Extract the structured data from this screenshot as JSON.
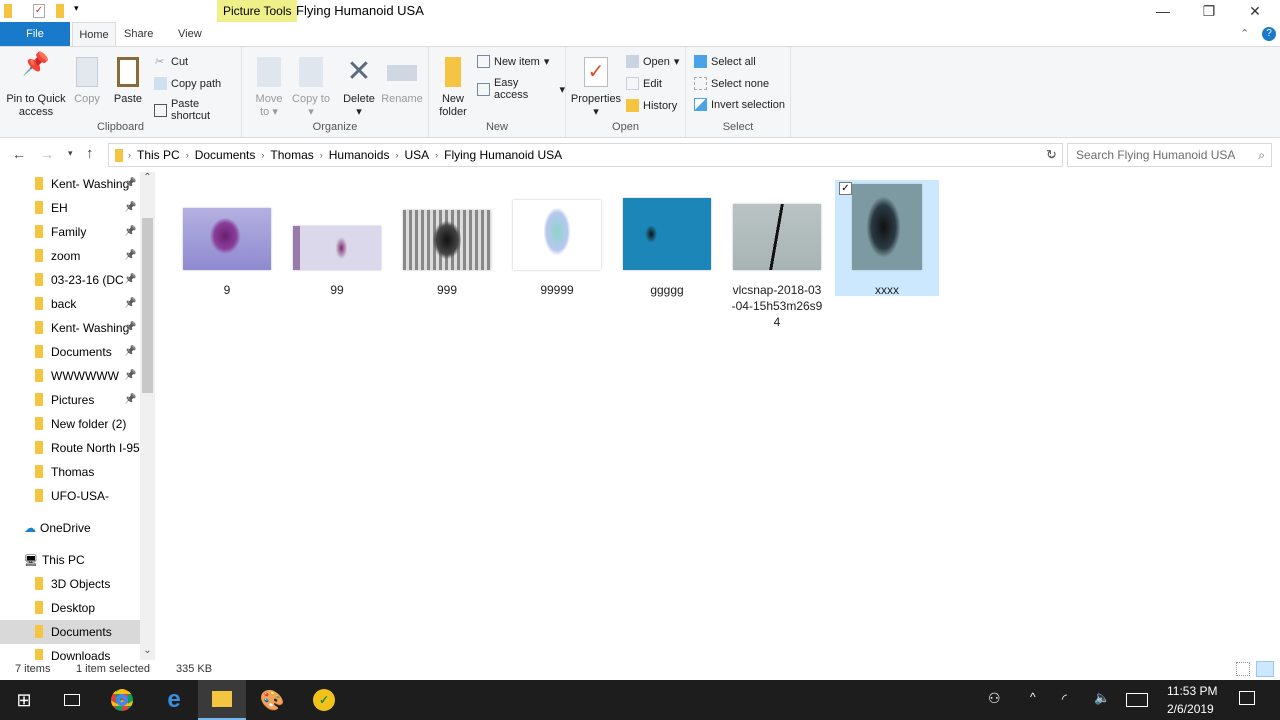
{
  "window": {
    "title": "Flying Humanoid USA",
    "context_tab": "Picture Tools"
  },
  "tabs": [
    "File",
    "Home",
    "Share",
    "View"
  ],
  "ribbon": {
    "clipboard": {
      "label": "Clipboard",
      "pin": "Pin to Quick access",
      "copy": "Copy",
      "paste": "Paste",
      "cut": "Cut",
      "copy_path": "Copy path",
      "paste_shortcut": "Paste shortcut"
    },
    "organize": {
      "label": "Organize",
      "move_to": "Move to",
      "copy_to": "Copy to",
      "delete": "Delete",
      "rename": "Rename"
    },
    "new": {
      "label": "New",
      "new_folder": "New folder",
      "new_item": "New item",
      "easy_access": "Easy access"
    },
    "open": {
      "label": "Open",
      "properties": "Properties",
      "open": "Open",
      "edit": "Edit",
      "history": "History"
    },
    "select": {
      "label": "Select",
      "select_all": "Select all",
      "select_none": "Select none",
      "invert": "Invert selection"
    }
  },
  "address": {
    "crumbs": [
      "This PC",
      "Documents",
      "Thomas",
      "Humanoids",
      "USA",
      "Flying Humanoid USA"
    ],
    "search_placeholder": "Search Flying Humanoid USA"
  },
  "nav": {
    "quick": [
      {
        "label": "Kent- Washing"
      },
      {
        "label": "EH"
      },
      {
        "label": "Family"
      },
      {
        "label": "zoom"
      },
      {
        "label": "03-23-16 (DC"
      },
      {
        "label": "back"
      },
      {
        "label": "Kent- Washing"
      },
      {
        "label": "Documents"
      },
      {
        "label": "WWWWWW"
      },
      {
        "label": "Pictures"
      },
      {
        "label": "New folder (2)"
      },
      {
        "label": "Route North I-95"
      },
      {
        "label": "Thomas"
      },
      {
        "label": "UFO-USA-"
      }
    ],
    "onedrive": "OneDrive",
    "thispc": "This PC",
    "pc_items": [
      {
        "label": "3D Objects"
      },
      {
        "label": "Desktop"
      },
      {
        "label": "Documents"
      },
      {
        "label": "Downloads"
      }
    ]
  },
  "files": [
    {
      "name": "9"
    },
    {
      "name": "99"
    },
    {
      "name": "999"
    },
    {
      "name": "99999"
    },
    {
      "name": "ggggg"
    },
    {
      "name": "vlcsnap-2018-03-04-15h53m26s94"
    },
    {
      "name": "xxxx",
      "selected": true
    }
  ],
  "status": {
    "count": "7 items",
    "selected": "1 item selected",
    "size": "335 KB"
  },
  "taskbar": {
    "time": "11:53 PM",
    "date": "2/6/2019"
  },
  "colors": {
    "accent": "#1979ca",
    "selection": "#cce8ff",
    "taskbar": "#1d1d1d"
  }
}
